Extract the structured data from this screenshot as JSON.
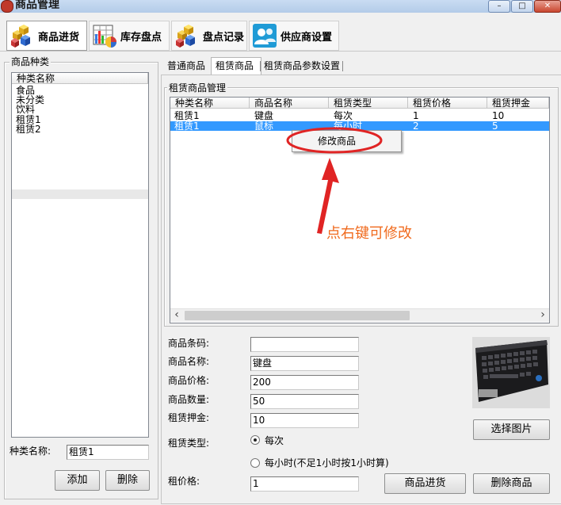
{
  "window": {
    "title": "商品管理",
    "minimize": "–",
    "maximize": "□",
    "close": "✕"
  },
  "toolbar": {
    "buttons": [
      {
        "label": "商品进货",
        "icon": "cubes-icon",
        "active": true
      },
      {
        "label": "库存盘点",
        "icon": "spreadsheet-chart-icon",
        "active": false
      },
      {
        "label": "盘点记录",
        "icon": "cubes-icon",
        "active": false
      },
      {
        "label": "供应商设置",
        "icon": "users-icon",
        "active": false
      }
    ]
  },
  "category_panel": {
    "legend": "商品种类",
    "column_header": "种类名称",
    "items": [
      "食品",
      "未分类",
      "饮料",
      "租赁1",
      "租赁2"
    ],
    "selected_index": 3,
    "name_label": "种类名称:",
    "name_value": "租赁1",
    "add_label": "添加",
    "delete_label": "删除"
  },
  "tabs": [
    "普通商品",
    "租赁商品",
    "租赁商品参数设置"
  ],
  "active_tab": 1,
  "rental_panel": {
    "legend": "租赁商品管理",
    "columns": [
      "种类名称",
      "商品名称",
      "租赁类型",
      "租赁价格",
      "租赁押金"
    ],
    "rows": [
      [
        "租赁1",
        "键盘",
        "每次",
        "1",
        "10"
      ],
      [
        "租赁1",
        "鼠标",
        "每小时",
        "2",
        "5"
      ]
    ],
    "selected_row": 1,
    "context_menu_item": "修改商品",
    "annotation": "点右键可修改",
    "annotation_color": "#f06a1d",
    "scroll_left": "‹",
    "scroll_right": "›"
  },
  "form": {
    "barcode_label": "商品条码:",
    "barcode_value": "",
    "name_label": "商品名称:",
    "name_value": "键盘",
    "price_label": "商品价格:",
    "price_value": "200",
    "qty_label": "商品数量:",
    "qty_value": "50",
    "deposit_label": "租赁押金:",
    "deposit_value": "10",
    "rent_type_label": "租赁类型:",
    "rent_type_options": [
      "每次",
      "每小时(不足1小时按1小时算)"
    ],
    "rent_type_selected": 0,
    "rent_price_label": "租价格:",
    "rent_price_value": "1",
    "choose_image_label": "选择图片",
    "stock_in_label": "商品进货",
    "delete_label": "删除商品"
  },
  "colors": {
    "selection": "#3399ff",
    "accent_red": "#e02424"
  }
}
